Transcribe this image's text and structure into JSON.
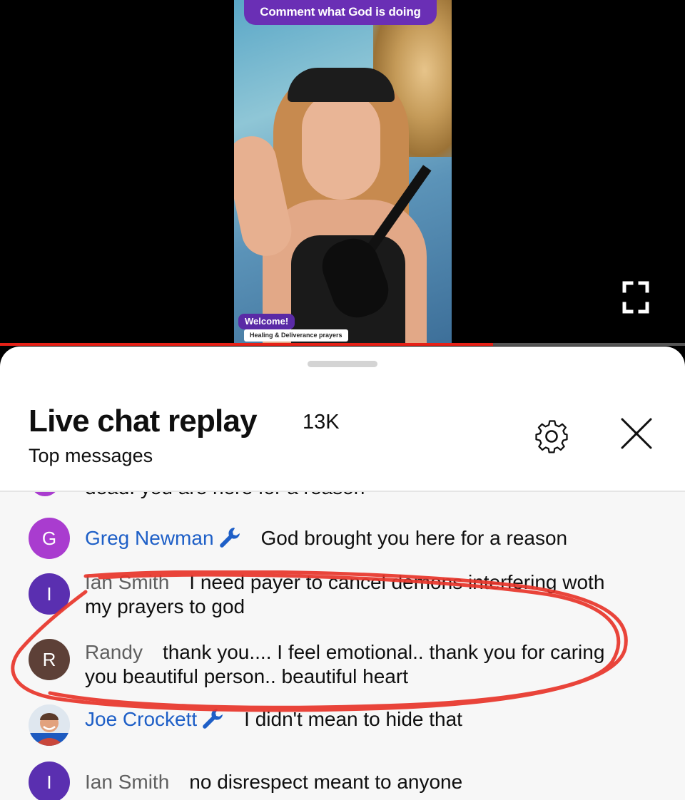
{
  "video": {
    "top_banner": "Comment what God is doing",
    "welcome_badge": "Welcome!",
    "welcome_subtitle": "Healing & Deliverance prayers",
    "progress_fraction": 0.72,
    "icons": {
      "fullscreen": "fullscreen-icon"
    }
  },
  "chat": {
    "title": "Live chat replay",
    "count": "13K",
    "filter": "Top messages",
    "icons": {
      "settings": "gear-icon",
      "close": "close-icon"
    },
    "partial_line": "dead. you are here for a reason",
    "messages": [
      {
        "avatar": "G",
        "avatar_color": "#a93ccf",
        "author": "Greg Newman",
        "owner": true,
        "text": "God brought you here for a reason"
      },
      {
        "avatar": "I",
        "avatar_color": "#5a2fb0",
        "author": "Ian Smith",
        "owner": false,
        "text": "I need payer to cancel demons interfering woth my prayers to god"
      },
      {
        "avatar": "R",
        "avatar_color": "#5d4037",
        "author": "Randy",
        "owner": false,
        "text": "thank you.... I feel emotional.. thank you for caring you beautiful person.. beautiful heart"
      },
      {
        "avatar": "",
        "avatar_color": "#c8473b",
        "author": "Joe Crockett",
        "owner": true,
        "text": "I didn't mean to hide that"
      },
      {
        "avatar": "I",
        "avatar_color": "#5a2fb0",
        "author": "Ian Smith",
        "owner": false,
        "text": "no disrespect meant to anyone"
      }
    ]
  },
  "colors": {
    "accent_red": "#e62117",
    "owner_blue": "#1e5fc7",
    "annotation_red": "#e8352b"
  }
}
